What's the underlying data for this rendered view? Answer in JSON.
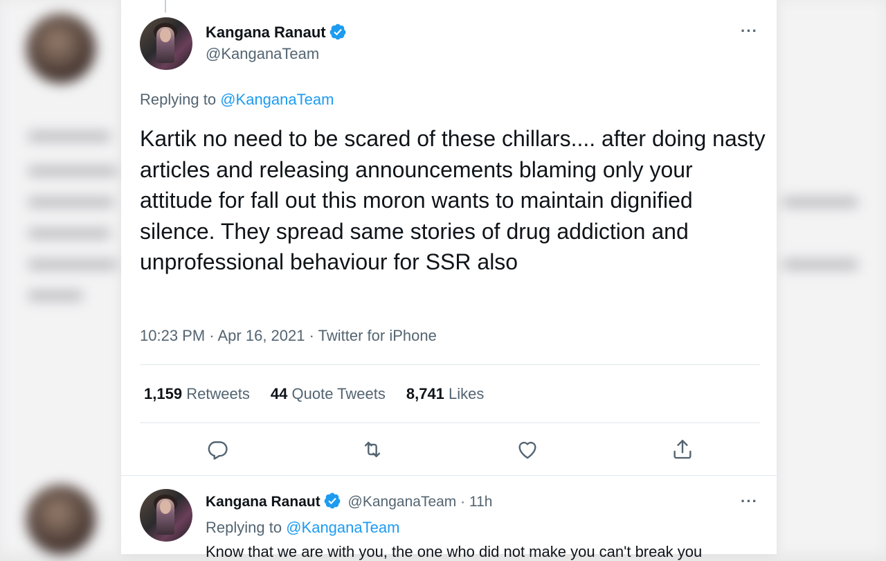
{
  "main_tweet": {
    "author_name": "Kangana Ranaut",
    "author_handle": "@KanganaTeam",
    "replying_to_label": "Replying to",
    "replying_to_handle": "@KanganaTeam",
    "text": "Kartik no need to be scared of these chillars.... after doing nasty articles and releasing announcements blaming only your attitude for fall out this moron wants to maintain dignified silence. They spread same stories of drug addiction and unprofessional behaviour for SSR also",
    "timestamp": "10:23 PM · Apr 16, 2021 · Twitter for iPhone",
    "more_label": "···",
    "stats": {
      "retweets_count": "1,159",
      "retweets_label": "Retweets",
      "quotes_count": "44",
      "quotes_label": "Quote Tweets",
      "likes_count": "8,741",
      "likes_label": "Likes"
    },
    "actions": [
      "reply-icon",
      "retweet-icon",
      "like-icon",
      "share-icon"
    ]
  },
  "reply_tweet": {
    "author_name": "Kangana Ranaut",
    "author_handle": "@KanganaTeam",
    "time_ago": "· 11h",
    "replying_to_label": "Replying to",
    "replying_to_handle": "@KanganaTeam",
    "text": "Know that we are with you, the one who did not make you can't break you",
    "more_label": "···"
  },
  "colors": {
    "accent": "#1d9bf0",
    "secondary_text": "#536471",
    "primary_text": "#0f1419"
  }
}
